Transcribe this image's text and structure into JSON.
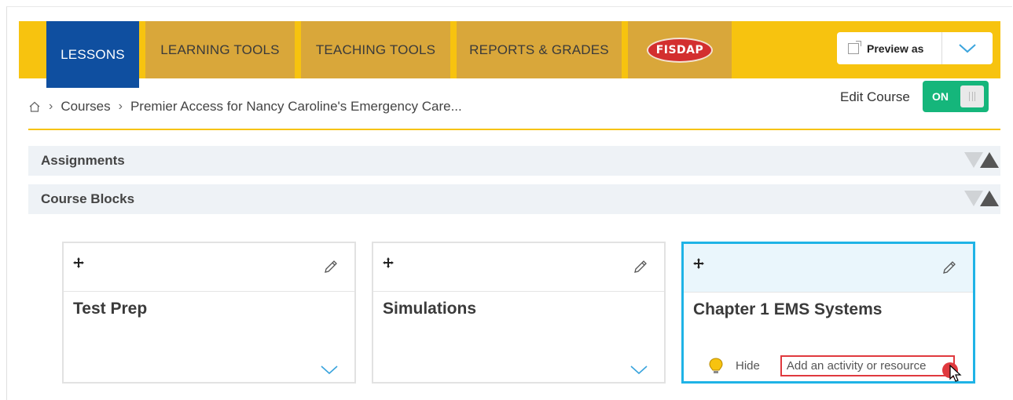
{
  "nav": {
    "tabs": [
      {
        "label": "LESSONS",
        "active": true
      },
      {
        "label": "LEARNING TOOLS"
      },
      {
        "label": "TEACHING TOOLS"
      },
      {
        "label": "REPORTS & GRADES"
      }
    ],
    "fisdap_logo_text": "FISDAP",
    "preview_label": "Preview as"
  },
  "breadcrumb": {
    "items": [
      "Courses",
      "Premier Access for Nancy Caroline's Emergency Care..."
    ]
  },
  "edit_course": {
    "label": "Edit Course",
    "toggle_text": "ON"
  },
  "sections": {
    "assignments": "Assignments",
    "course_blocks": "Course Blocks"
  },
  "cards": [
    {
      "title": "Test Prep"
    },
    {
      "title": "Simulations"
    },
    {
      "title": "Chapter 1 EMS Systems",
      "hide_label": "Hide",
      "add_label": "Add an activity or resource"
    }
  ],
  "colors": {
    "accent_yellow": "#f7c30f",
    "active_tab": "#0f4fa0",
    "toggle_green": "#15b67b",
    "highlight_blue": "#1fb3e6",
    "highlight_red": "#e0393e"
  }
}
